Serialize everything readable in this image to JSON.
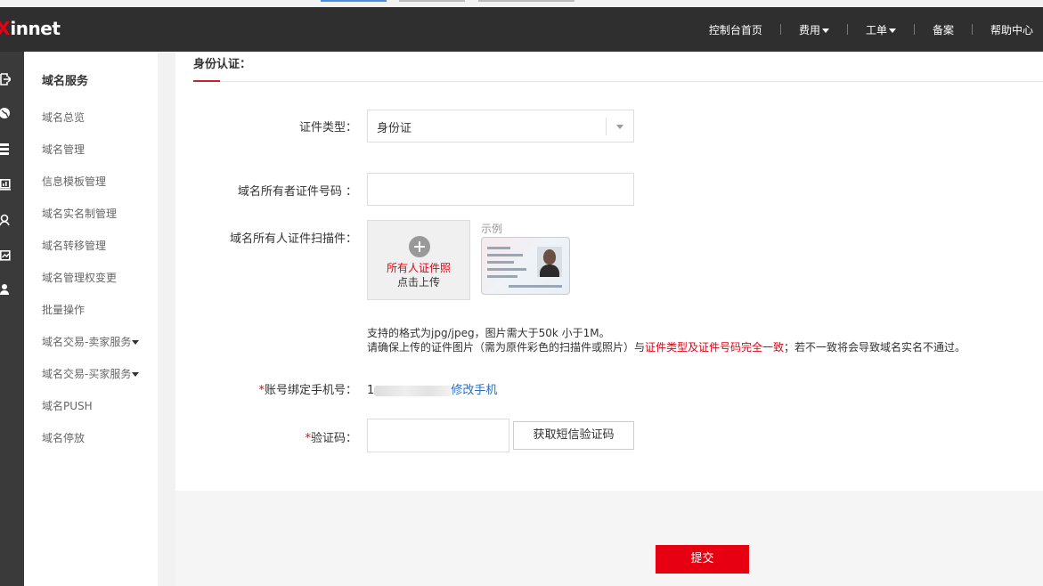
{
  "header": {
    "logo_mark": "X",
    "logo_text": "innet",
    "nav": [
      {
        "label": "控制台首页",
        "dropdown": false
      },
      {
        "label": "费用",
        "dropdown": true
      },
      {
        "label": "工单",
        "dropdown": true
      },
      {
        "label": "备案",
        "dropdown": false
      },
      {
        "label": "帮助中心",
        "dropdown": false
      }
    ]
  },
  "rail": {
    "icons": [
      "logout-icon",
      "globe-icon",
      "server-icon",
      "monitor-icon",
      "user-icon",
      "chart-icon",
      "support-icon"
    ]
  },
  "sidebar": {
    "title": "域名服务",
    "items": [
      {
        "label": "域名总览",
        "dropdown": false
      },
      {
        "label": "域名管理",
        "dropdown": false
      },
      {
        "label": "信息模板管理",
        "dropdown": false
      },
      {
        "label": "域名实名制管理",
        "dropdown": false
      },
      {
        "label": "域名转移管理",
        "dropdown": false
      },
      {
        "label": "域名管理权变更",
        "dropdown": false
      },
      {
        "label": "批量操作",
        "dropdown": false
      },
      {
        "label": "域名交易-卖家服务",
        "dropdown": true
      },
      {
        "label": "域名交易-买家服务",
        "dropdown": true
      },
      {
        "label": "域名PUSH",
        "dropdown": false
      },
      {
        "label": "域名停放",
        "dropdown": false
      }
    ]
  },
  "form": {
    "section_title": "身份认证：",
    "cert_type_label": "证件类型：",
    "cert_type_value": "身份证",
    "cert_number_label": "域名所有者证件号码 ：",
    "cert_number_value": "",
    "scan_label": "域名所有人证件扫描件：",
    "upload_line1": "所有人证件照",
    "upload_line2": "点击上传",
    "example_label": "示例",
    "hint_line1": "支持的格式为jpg/jpeg，图片需大于50k 小于1M。",
    "hint_line2_a": "请确保上传的证件图片（需为原件彩色的扫描件或照片）与",
    "hint_line2_red": "证件类型及证件号码完全一致",
    "hint_line2_b": "；若不一致将会导致域名实名不通过。",
    "required_mark": "*",
    "phone_label": "账号绑定手机号：",
    "phone_prefix": "1",
    "change_phone_link": "修改手机",
    "code_label": "验证码：",
    "code_value": "",
    "sms_button": "获取短信验证码",
    "submit_button": "提交"
  },
  "colors": {
    "accent": "#e60012",
    "link": "#2a6ebb",
    "header_bg": "#2f2f2f"
  }
}
